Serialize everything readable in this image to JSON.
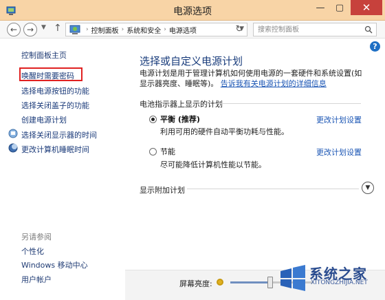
{
  "window": {
    "title": "电源选项",
    "min_symbol": "—",
    "max_symbol": "▢",
    "close_symbol": "✕"
  },
  "nav": {
    "breadcrumbs": [
      "控制面板",
      "系统和安全",
      "电源选项"
    ],
    "search_placeholder": "搜索控制面板"
  },
  "sidebar": {
    "home_link": "控制面板主页",
    "links": [
      "唤醒时需要密码",
      "选择电源按钮的功能",
      "选择关闭盖子的功能",
      "创建电源计划",
      "选择关闭显示器的时间",
      "更改计算机睡眠时间"
    ],
    "see_also_heading": "另请参阅",
    "see_also_links": [
      "个性化",
      "Windows 移动中心",
      "用户帐户"
    ]
  },
  "main": {
    "help_symbol": "?",
    "title": "选择或自定义电源计划",
    "description": "电源计划是用于管理计算机如何使用电源的一套硬件和系统设置(如显示器亮度、睡眠等)。",
    "description_link": "告诉我有关电源计划的详细信息",
    "battery_group_label": "电池指示器上显示的计划",
    "plans": [
      {
        "name": "平衡 (推荐)",
        "desc": "利用可用的硬件自动平衡功耗与性能。",
        "selected": true,
        "change_label": "更改计划设置"
      },
      {
        "name": "节能",
        "desc": "尽可能降低计算机性能以节能。",
        "selected": false,
        "change_label": "更改计划设置"
      }
    ],
    "more_plans_label": "显示附加计划"
  },
  "bottom": {
    "brightness_label": "屏幕亮度:",
    "brightness_fraction": 0.48
  },
  "watermark": {
    "text": "系统之家",
    "sub": "XITONGZHIJIA.NET"
  },
  "colors": {
    "titlebar": "#f8d4a6",
    "close_button": "#c7413c",
    "link": "#1a55b4",
    "highlight_box": "#e02020"
  }
}
